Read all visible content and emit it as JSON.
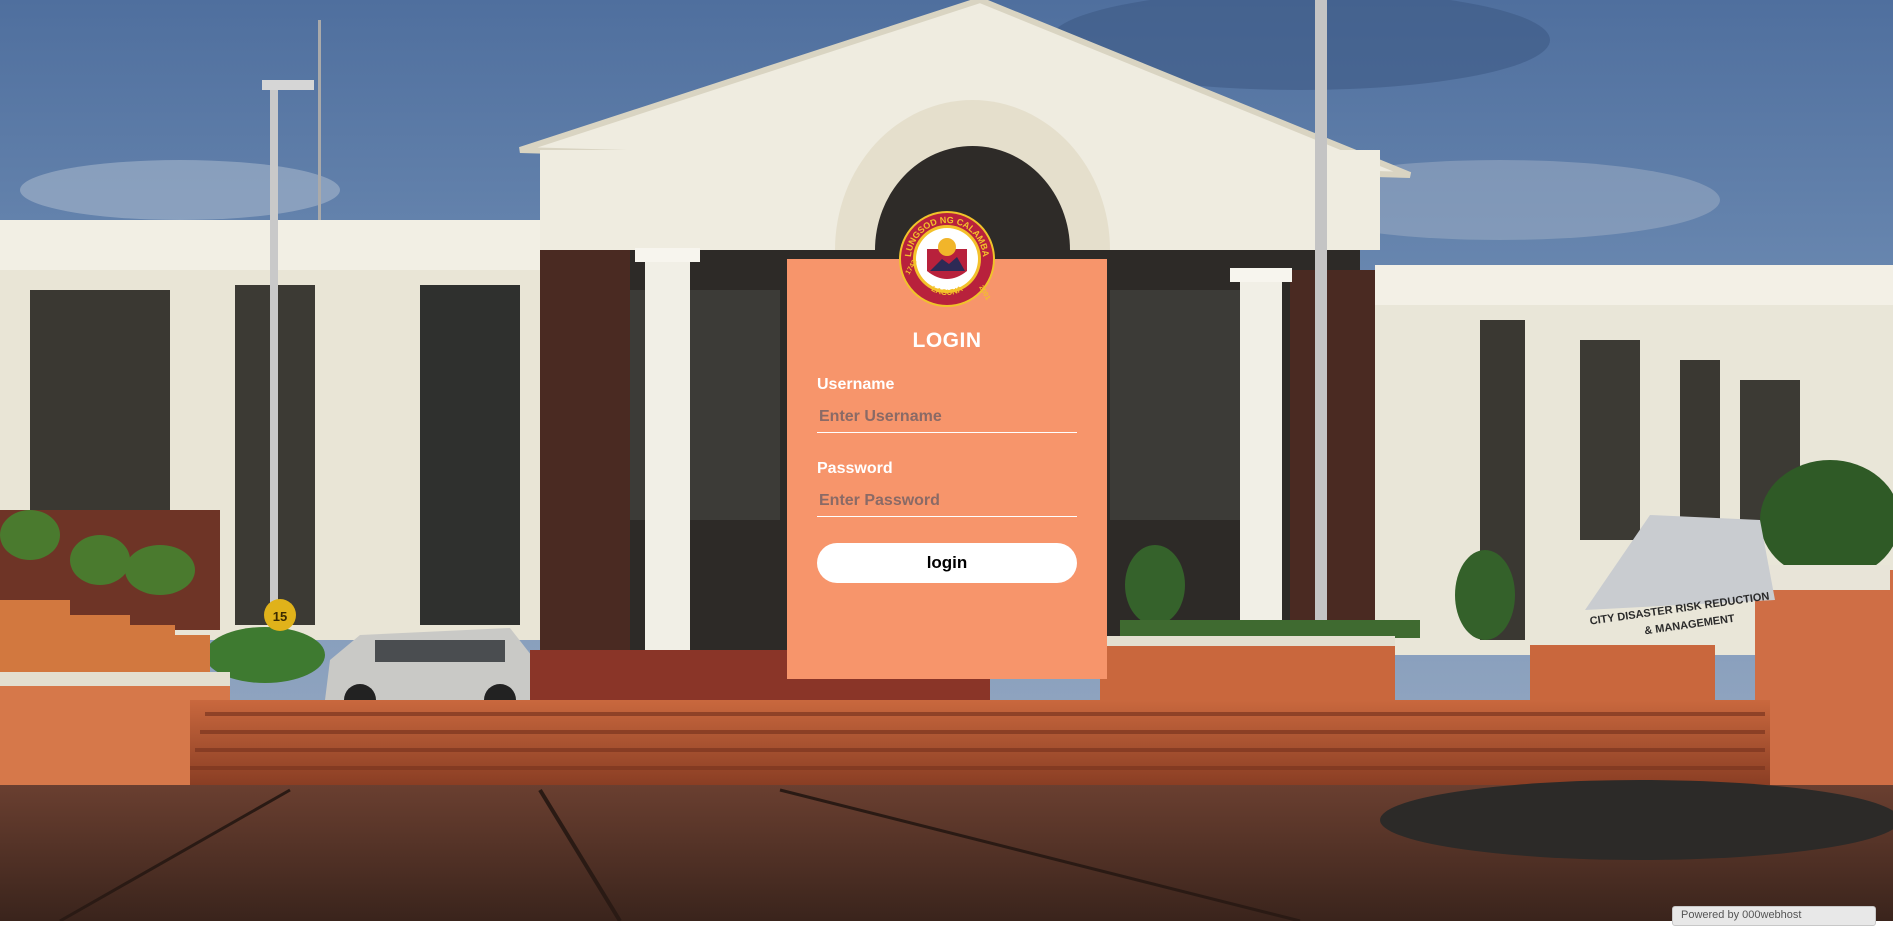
{
  "login": {
    "title": "LOGIN",
    "username_label": "Username",
    "username_placeholder": "Enter Username",
    "username_value": "",
    "password_label": "Password",
    "password_placeholder": "Enter Password",
    "password_value": "",
    "submit_label": "login"
  },
  "seal": {
    "top_text": "LUNGSOD NG CALAMBA",
    "bottom_text": "LAGUNA",
    "year_left": "1742",
    "year_right": "2001"
  },
  "background": {
    "tent_text_1": "CITY DISASTER RISK REDUCTION",
    "tent_text_2": "& MANAGEMENT",
    "sign_number": "15"
  },
  "footer": {
    "badge_text": "Powered by 000webhost"
  },
  "colors": {
    "card": "#f7956b",
    "button": "#ffffff",
    "sky": "#5a7aa5",
    "building": "#efece0",
    "pillar_dark": "#4a2a22",
    "steps": "#c8623a"
  }
}
